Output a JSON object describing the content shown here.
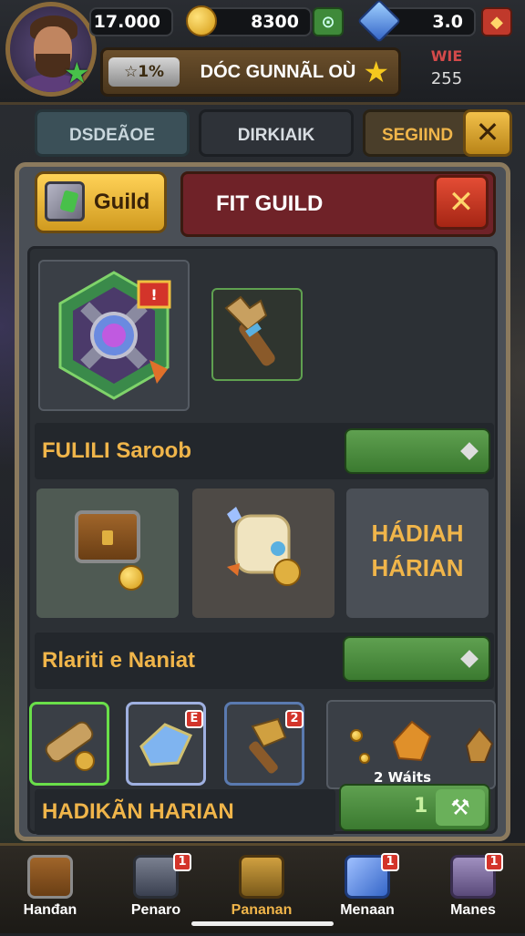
{
  "player": {
    "level_icon": "green-star-icon"
  },
  "resources": {
    "coins": "17.000",
    "gold": "8300",
    "gems": "3.0"
  },
  "title_bar": {
    "rank": "1%",
    "title": "DÓC GUNNÃL OÙ"
  },
  "vip": {
    "label": "WIE",
    "value": "255"
  },
  "tabs": [
    {
      "label": "DSDEÃOE"
    },
    {
      "label": "DIRKIAIK"
    },
    {
      "label": "SEGIIND"
    }
  ],
  "panel": {
    "guild_button": "Guild",
    "header_title": "FIT GUILD"
  },
  "sections": {
    "first": "FULILI Saroob",
    "second": "Rlariti e Naniat",
    "third": "HADIKÃN HARIAN"
  },
  "card3": {
    "line1": "HÁDIAH",
    "line2": "HÁRIAN"
  },
  "items": {
    "badge1": "E",
    "badge2": "2",
    "count_label": "2 Wáits"
  },
  "claim_count": "1",
  "nav": [
    {
      "label": "Hanđan",
      "badge": ""
    },
    {
      "label": "Penaro",
      "badge": "1"
    },
    {
      "label": "Pananan",
      "badge": ""
    },
    {
      "label": "Menaan",
      "badge": "1"
    },
    {
      "label": "Manes",
      "badge": "1"
    }
  ],
  "colors": {
    "accent_gold": "#f0b54a",
    "green_button": "#4f8f42",
    "red_header": "#6f2228"
  }
}
